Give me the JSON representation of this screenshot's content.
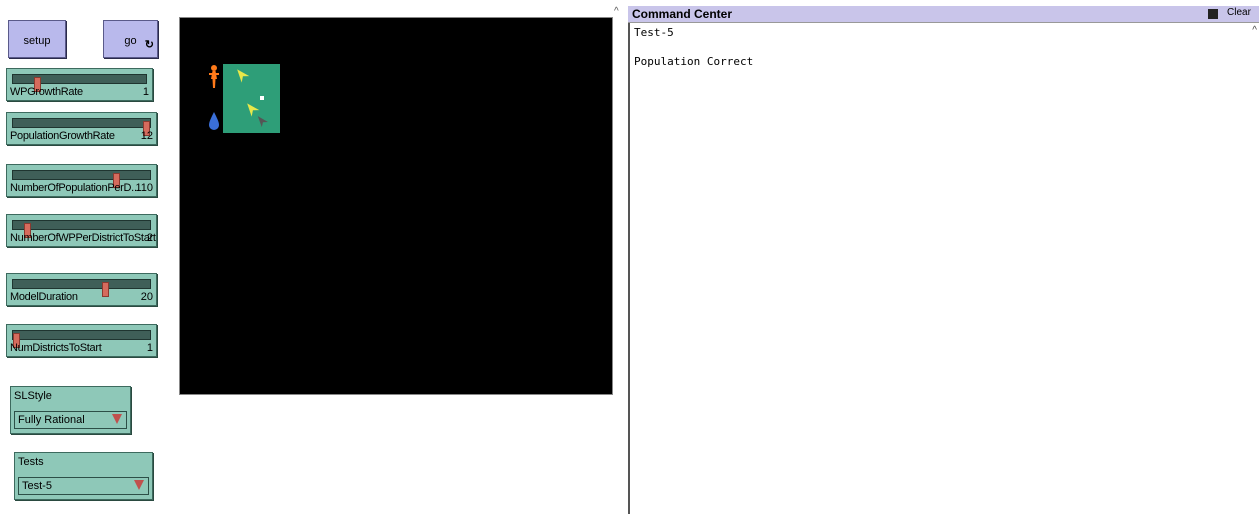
{
  "buttons": {
    "setup": "setup",
    "go": "go",
    "forever_glyph": "↻"
  },
  "sliders": [
    {
      "name": "WPGrowthRate",
      "value": "1",
      "level": 0.18
    },
    {
      "name": "PopulationGrowthRate",
      "value": "12",
      "level": 1.0
    },
    {
      "name": "NumberOfPopulationPerD...",
      "value": "110",
      "level": 0.75
    },
    {
      "name": "NumberOfWPPerDistrictToStart",
      "value": "2",
      "level": 0.1
    },
    {
      "name": "ModelDuration",
      "value": "20",
      "level": 0.67
    },
    {
      "name": "NumDistrictsToStart",
      "value": "1",
      "level": 0.0
    }
  ],
  "choosers": {
    "slstyle": {
      "name": "SLStyle",
      "value": "Fully Rational"
    },
    "tests": {
      "name": "Tests",
      "value": "Test-5"
    }
  },
  "command_center": {
    "title": "Command Center",
    "clear": "Clear",
    "lines": [
      "Test-5",
      "",
      "Population Correct"
    ]
  },
  "colors": {
    "patch_green": "#2e9e78",
    "person_orange": "#ff7a1a",
    "drop_blue": "#3a6fd8"
  },
  "icons": [
    "person-icon",
    "water-drop-icon",
    "arrow-turtle-icon"
  ]
}
